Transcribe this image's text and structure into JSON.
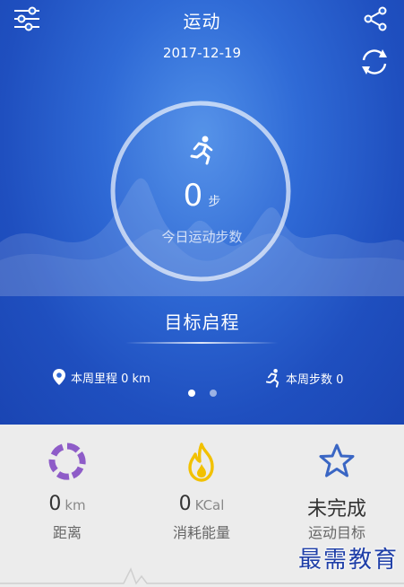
{
  "header": {
    "title": "运动",
    "date": "2017-12-19",
    "icons": {
      "left": "settings-sliders-icon",
      "share": "share-icon",
      "sync": "sync-icon"
    }
  },
  "ring": {
    "steps_value": "0",
    "steps_unit": "步",
    "steps_label": "今日运动步数",
    "icon": "running-icon"
  },
  "goal": {
    "label": "目标启程"
  },
  "weekly": {
    "distance_label": "本周里程 0 km",
    "steps_label": "本周步数 0",
    "icons": {
      "distance": "location-pin-icon",
      "steps": "running-icon"
    }
  },
  "pager": {
    "pages": 2,
    "active": 1
  },
  "stats": {
    "distance": {
      "value": "0",
      "unit": "km",
      "label": "距离",
      "icon": "ring-segments-icon"
    },
    "energy": {
      "value": "0",
      "unit": "KCal",
      "label": "消耗能量",
      "icon": "flame-icon"
    },
    "goal": {
      "value": "未完成",
      "label": "运动目标",
      "icon": "star-icon"
    }
  },
  "watermark": "最需教育",
  "colors": {
    "hero_bg": "#2f6ad6",
    "purple": "#8e5cc8",
    "yellow": "#f2c100",
    "star_blue": "#3a66c4",
    "text_dark": "#333333"
  }
}
